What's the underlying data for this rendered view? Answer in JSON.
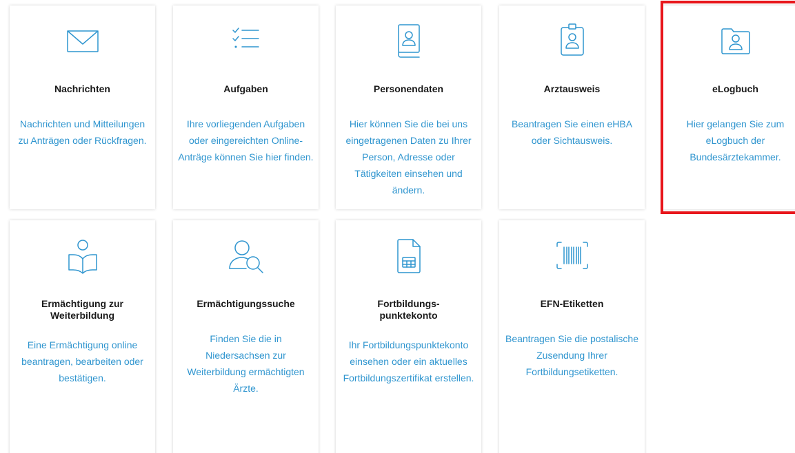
{
  "tiles": [
    {
      "title": "Nachrichten",
      "description": "Nachrichten und Mitteilungen zu Anträgen oder Rückfragen.",
      "icon": "envelope-icon"
    },
    {
      "title": "Aufgaben",
      "description": "Ihre vorliegenden Aufgaben oder eingereichten Online-Anträge können Sie hier finden.",
      "icon": "checklist-icon"
    },
    {
      "title": "Personendaten",
      "description": "Hier können Sie die bei uns eingetragenen Daten zu Ihrer Person, Adresse oder Tätigkeiten einsehen und ändern.",
      "icon": "person-book-icon"
    },
    {
      "title": "Arztausweis",
      "description": "Beantragen Sie einen eHBA oder Sichtausweis.",
      "icon": "id-badge-icon"
    },
    {
      "title": "eLogbuch",
      "description": "Hier gelangen Sie zum eLogbuch der Bundesärztekammer.",
      "icon": "person-folder-icon"
    },
    {
      "title": "Ermächtigung zur Weiterbildung",
      "description": "Eine Ermächtigung online beantragen, bearbeiten oder bestätigen.",
      "icon": "reader-icon"
    },
    {
      "title": "Ermächtigungssuche",
      "description": "Finden Sie die in Niedersachsen zur Weiterbildung ermächtigten Ärzte.",
      "icon": "person-search-icon"
    },
    {
      "title": "Fortbildungs-\npunktekonto",
      "description": "Ihr Fortbildungspunktekonto einsehen oder ein aktuelles Fortbildungszertifikat erstellen.",
      "icon": "calculator-document-icon"
    },
    {
      "title": "EFN-Etiketten",
      "description": "Beantragen Sie die postalische Zusendung Ihrer Fortbildungsetiketten.",
      "icon": "barcode-icon"
    }
  ],
  "colors": {
    "accent": "#2f95cf",
    "title": "#1a1a1a",
    "highlight": "#e8161b"
  }
}
